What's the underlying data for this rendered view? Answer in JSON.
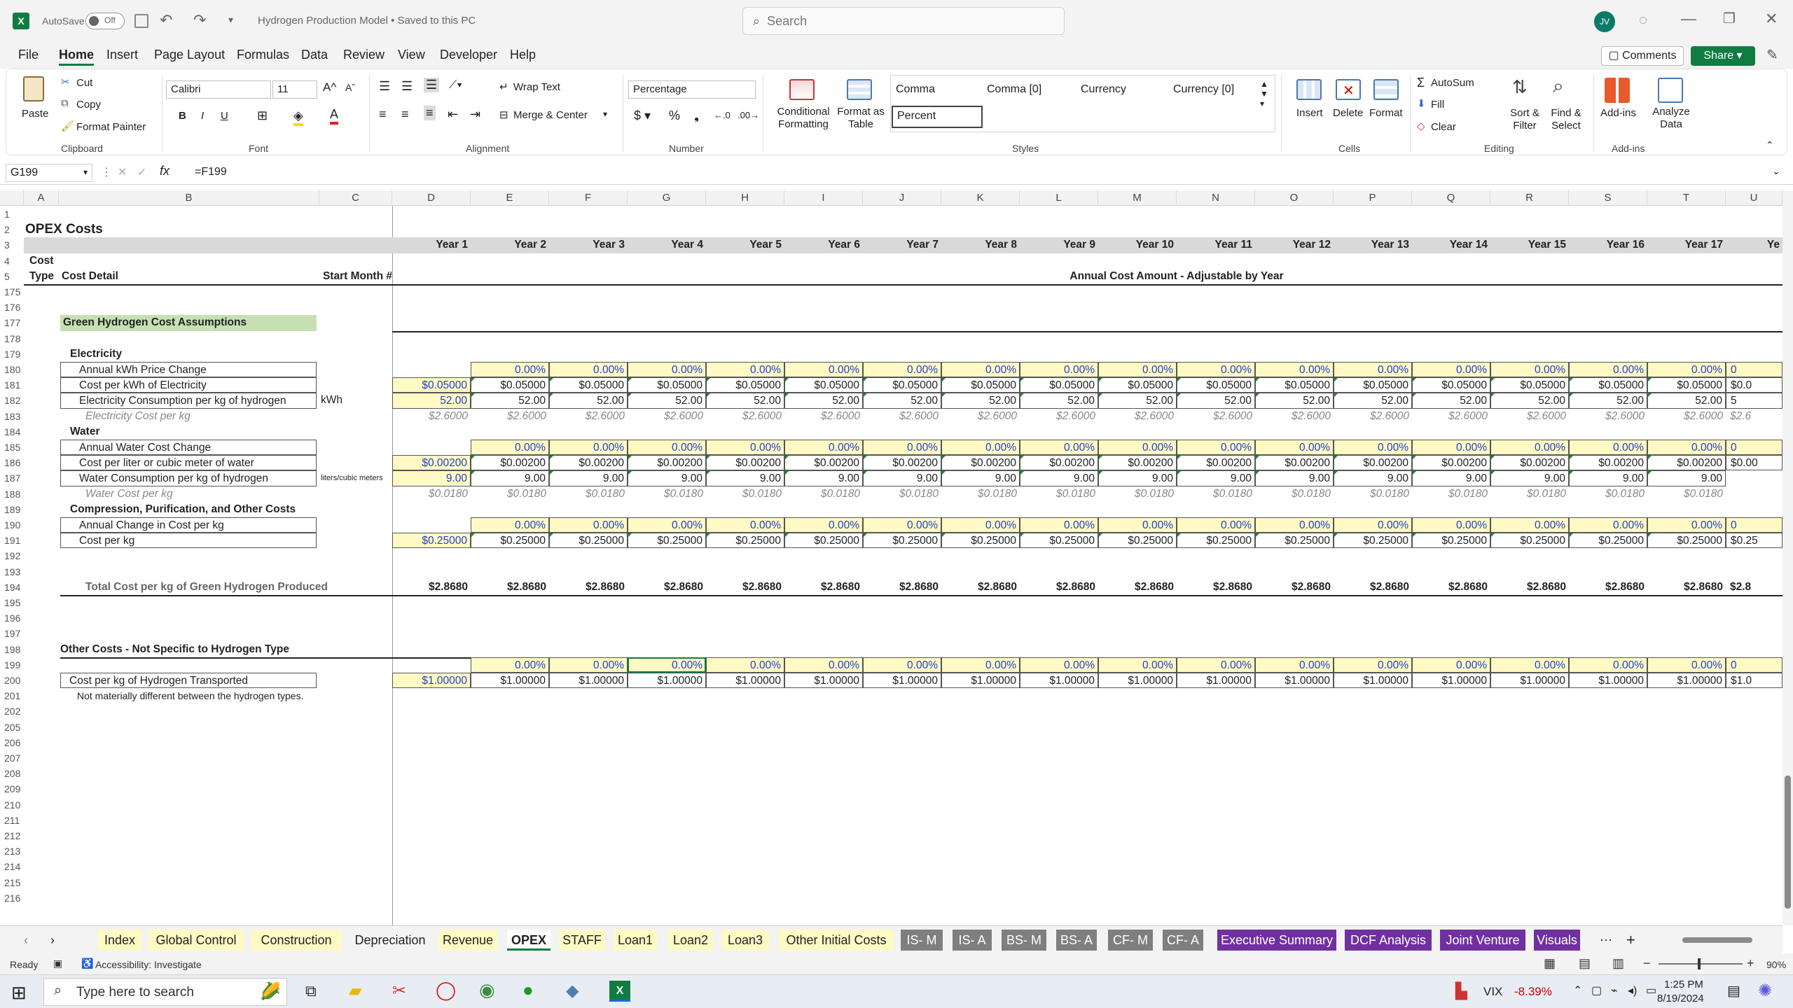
{
  "app": {
    "autosave_label": "AutoSave",
    "autosave_state": "Off",
    "doc_title": "Hydrogen Production Model • Saved to this PC",
    "search_placeholder": "Search",
    "user_initials": "JV"
  },
  "menu": [
    "File",
    "Home",
    "Insert",
    "Page Layout",
    "Formulas",
    "Data",
    "Review",
    "View",
    "Developer",
    "Help"
  ],
  "menu_right": {
    "comments": "Comments",
    "share": "Share"
  },
  "ribbon": {
    "clipboard": {
      "paste": "Paste",
      "cut": "Cut",
      "copy": "Copy",
      "format_painter": "Format Painter",
      "label": "Clipboard"
    },
    "font": {
      "name": "Calibri",
      "size": "11",
      "label": "Font"
    },
    "alignment": {
      "wrap": "Wrap Text",
      "merge": "Merge & Center",
      "label": "Alignment"
    },
    "number": {
      "format": "Percentage",
      "label": "Number"
    },
    "styles": {
      "cond": "Conditional Formatting",
      "table": "Format as Table",
      "s1": "Comma",
      "s2": "Comma [0]",
      "s3": "Currency",
      "s4": "Currency [0]",
      "s5": "Percent",
      "label": "Styles"
    },
    "cells": {
      "insert": "Insert",
      "delete": "Delete",
      "format": "Format",
      "label": "Cells"
    },
    "editing": {
      "autosum": "AutoSum",
      "fill": "Fill",
      "clear": "Clear",
      "sort": "Sort & Filter",
      "find": "Find & Select",
      "label": "Editing"
    },
    "addins": {
      "addins": "Add-ins",
      "analyze": "Analyze Data",
      "label": "Add-ins"
    }
  },
  "formula": {
    "namebox": "G199",
    "content": "=F199"
  },
  "columns": [
    "A",
    "B",
    "C",
    "D",
    "E",
    "F",
    "G",
    "H",
    "I",
    "J",
    "K",
    "L",
    "M",
    "N",
    "O",
    "P",
    "Q",
    "R",
    "S",
    "T",
    "U"
  ],
  "sheet": {
    "title": "OPEX Costs",
    "years": [
      "Year 1",
      "Year 2",
      "Year 3",
      "Year 4",
      "Year 5",
      "Year 6",
      "Year 7",
      "Year 8",
      "Year 9",
      "Year 10",
      "Year 11",
      "Year 12",
      "Year 13",
      "Year 14",
      "Year 15",
      "Year 16",
      "Year 17",
      "Ye"
    ],
    "hdr_cost": "Cost",
    "hdr_type": "Type",
    "hdr_detail": "Cost Detail",
    "hdr_start": "Start Month #",
    "hdr_annual": "Annual Cost Amount - Adjustable by Year",
    "rows": [
      "1",
      "2",
      "3",
      "4",
      "5",
      "175",
      "176",
      "177",
      "178",
      "179",
      "180",
      "181",
      "182",
      "183",
      "184",
      "185",
      "186",
      "187",
      "188",
      "189",
      "190",
      "191",
      "192",
      "193",
      "194",
      "195",
      "196",
      "197",
      "198",
      "199",
      "200",
      "201",
      "202",
      "205",
      "206",
      "207",
      "208",
      "209",
      "210",
      "211",
      "212",
      "213",
      "214",
      "215",
      "216"
    ],
    "sec_green": "Green Hydrogen Cost Assumptions",
    "electricity": "Electricity",
    "e1": "Annual kWh Price Change",
    "e2": "Cost per kWh of Electricity",
    "e3": "Electricity Consumption per kg of hydrogen",
    "e3_unit": "kWh",
    "e4": "Electricity Cost per kg",
    "water": "Water",
    "w1": "Annual Water Cost Change",
    "w2": "Cost per liter or cubic meter of water",
    "w3": "Water Consumption per kg of hydrogen",
    "w3_unit": "liters/cubic meters",
    "w4": "Water Cost per kg",
    "comp": "Compression, Purification, and Other Costs",
    "c1": "Annual Change in Cost per kg",
    "c2": "Cost per kg",
    "total": "Total Cost per kg of Green Hydrogen Produced",
    "other": "Other Costs - Not Specific to Hydrogen Type",
    "o1": "Cost per kg of Hydrogen Transported",
    "o_note": "Not materially different between the hydrogen types.",
    "v_pct": "0.00%",
    "v_kwh": "$0.05000",
    "v_kwh_cut": "$0.0",
    "v_cons": "52.00",
    "v_cons_cut": "5",
    "v_ecost": "$2.6000",
    "v_ecost_cut": "$2.6",
    "v_water": "$0.00200",
    "v_water_cut": "$0.00",
    "v_wcons": "9.00",
    "v_wcost": "$0.0180",
    "v_ckg": "$0.25000",
    "v_ckg_cut": "$0.25",
    "v_total": "$2.8680",
    "v_total_cut": "$2.8",
    "v_trans": "$1.00000",
    "v_trans_cut": "$1.0",
    "v_pct_cut": "0"
  },
  "tabs": [
    "Index",
    "Global Control",
    "Construction",
    "Depreciation",
    "Revenue",
    "OPEX",
    "STAFF",
    "Loan1",
    "Loan2",
    "Loan3",
    "Other Initial Costs",
    "IS- M",
    "IS- A",
    "BS- M",
    "BS- A",
    "CF- M",
    "CF- A",
    "Executive Summary",
    "DCF Analysis",
    "Joint Venture",
    "Visuals"
  ],
  "status": {
    "ready": "Ready",
    "accessibility": "Accessibility: Investigate",
    "zoom": "90%"
  },
  "taskbar": {
    "search": "Type here to search",
    "ticker": "VIX",
    "change": "-8.39%",
    "time": "1:25 PM",
    "date": "8/19/2024"
  }
}
